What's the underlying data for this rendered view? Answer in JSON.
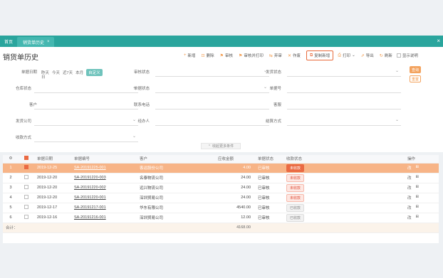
{
  "tabs": {
    "home": "首页",
    "active": "销货单历史",
    "close": "×"
  },
  "window_close": "×",
  "page_title": "销货单历史",
  "toolbar": [
    {
      "icon": "+",
      "label": "新增"
    },
    {
      "icon": "⊡",
      "label": "删除"
    },
    {
      "icon": "⚑",
      "label": "审核"
    },
    {
      "icon": "⚑",
      "label": "审核并打印"
    },
    {
      "icon": "⇆",
      "label": "弃审"
    },
    {
      "icon": "✕",
      "label": "作废"
    },
    {
      "icon": "⧉",
      "label": "复制新增"
    },
    {
      "icon": "⎙",
      "label": "打印"
    },
    {
      "icon": "⇗",
      "label": "导出"
    },
    {
      "icon": "↻",
      "label": "刷新"
    }
  ],
  "toggle_label": "显示说明",
  "filters": {
    "date_label": "单据日期",
    "date_options": [
      "昨天",
      "今天",
      "近7天",
      "本月",
      "自定义"
    ],
    "date_extra": "日",
    "status": "审核状态",
    "shipping": "发货状态",
    "warehouse": "仓库状态",
    "doc_status": "单据状态",
    "remark": "单据号",
    "customer": "客户",
    "contact": "联系电话",
    "sales": "客服",
    "shipper": "发货公司",
    "handler": "经办人",
    "settle": "结算方式",
    "source": "收款方式"
  },
  "search_btn": "查询",
  "reset_btn": "重置",
  "collapse_label": "收起更多条件",
  "grid": {
    "headers": [
      "单据日期",
      "单据编号",
      "客户",
      "应收金额",
      "单据状态",
      "收款状态",
      "操作"
    ],
    "rows": [
      {
        "idx": "1",
        "date": "2019-12-25",
        "no": "SA-20191225-001",
        "customer": "客运股份公司",
        "amount": "4.00",
        "status": "已审核",
        "pay": "未收款",
        "pay_type": "red",
        "checked": true
      },
      {
        "idx": "2",
        "date": "2019-12-20",
        "no": "SA-20191220-003",
        "customer": "名泰物流公司",
        "amount": "24.00",
        "status": "已审核",
        "pay": "未收款",
        "pay_type": "red",
        "checked": false
      },
      {
        "idx": "3",
        "date": "2019-12-20",
        "no": "SA-20191220-002",
        "customer": "远兴物流公司",
        "amount": "24.00",
        "status": "已审核",
        "pay": "未收款",
        "pay_type": "red",
        "checked": false
      },
      {
        "idx": "4",
        "date": "2019-12-20",
        "no": "SA-20191220-001",
        "customer": "深圳贸易公司",
        "amount": "24.00",
        "status": "已审核",
        "pay": "未收款",
        "pay_type": "red",
        "checked": false
      },
      {
        "idx": "5",
        "date": "2019-12-17",
        "no": "SA-20191217-001",
        "customer": "华东有限公司",
        "amount": "4540.00",
        "status": "已审核",
        "pay": "已收款",
        "pay_type": "gray",
        "checked": false
      },
      {
        "idx": "6",
        "date": "2019-12-16",
        "no": "SA-20191216-001",
        "customer": "深圳贸易公司",
        "amount": "12.00",
        "status": "已审核",
        "pay": "已收款",
        "pay_type": "gray",
        "checked": false
      }
    ],
    "ops": [
      "改",
      "⊞"
    ],
    "total_label": "合计：",
    "total_amount": "4168.00"
  }
}
